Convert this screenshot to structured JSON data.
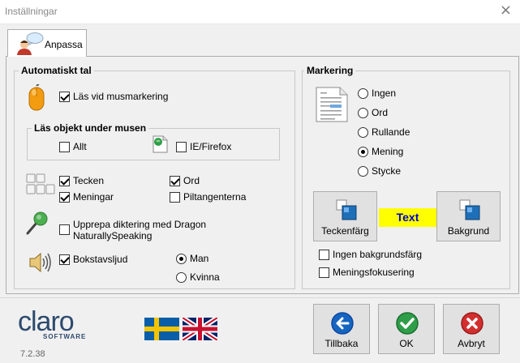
{
  "window": {
    "title": "Inställningar",
    "close_glyph": "×"
  },
  "tab": {
    "label": "Anpassa"
  },
  "auto": {
    "title": "Automatiskt tal",
    "read_on_mouse": "Läs vid musmarkering",
    "objects_title": "Läs objekt under musen",
    "all": "Allt",
    "iefirefox": "IE/Firefox",
    "chars": "Tecken",
    "words": "Ord",
    "sentences": "Meningar",
    "arrowkeys": "Piltangenterna",
    "dragon_line1": "Upprepa diktering med Dragon",
    "dragon_line2": "NaturallySpeaking",
    "letter_sound": "Bokstavsljud",
    "man": "Man",
    "woman": "Kvinna"
  },
  "marking": {
    "title": "Markering",
    "none": "Ingen",
    "word": "Ord",
    "scrolling": "Rullande",
    "sentence": "Mening",
    "paragraph": "Stycke",
    "text_color": "Teckenfärg",
    "sample_text": "Text",
    "background": "Bakgrund",
    "no_bg_color": "Ingen bakgrundsfärg",
    "sentence_focus": "Meningsfokusering",
    "highlight_color": "#ffff00",
    "sample_text_color": "#0000c8"
  },
  "footer": {
    "logo_main": "claro",
    "logo_sub": "SOFTWARE",
    "version": "7.2.38",
    "help": "Tillbaka",
    "ok": "OK",
    "cancel": "Avbryt"
  }
}
